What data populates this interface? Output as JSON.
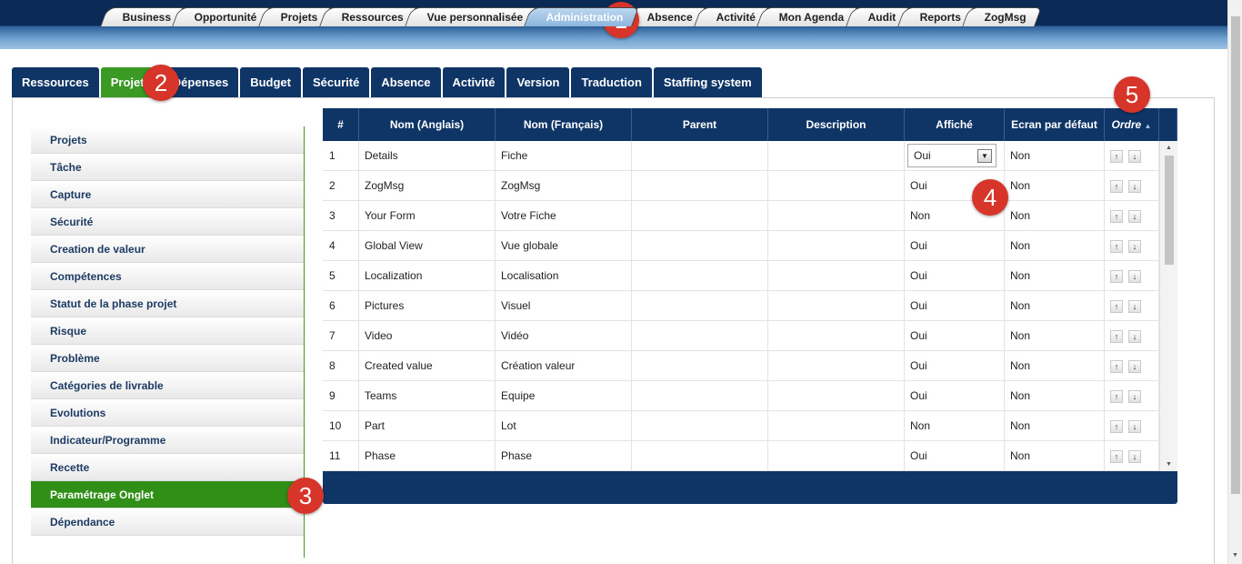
{
  "main_tabs": [
    "Business",
    "Opportunité",
    "Projets",
    "Ressources",
    "Vue personnalisée",
    "Administration",
    "Absence",
    "Activité",
    "Mon Agenda",
    "Audit",
    "Reports",
    "ZogMsg"
  ],
  "sub_tabs": [
    "Ressources",
    "Projets",
    "Dépenses",
    "Budget",
    "Sécurité",
    "Absence",
    "Activité",
    "Version",
    "Traduction",
    "Staffing system"
  ],
  "sidebar": {
    "items": [
      "Projets",
      "Tâche",
      "Capture",
      "Sécurité",
      "Creation de valeur",
      "Compétences",
      "Statut de la phase projet",
      "Risque",
      "Problème",
      "Catégories de livrable",
      "Evolutions",
      "Indicateur/Programme",
      "Recette",
      "Paramétrage Onglet",
      "Dépendance"
    ]
  },
  "grid": {
    "columns": {
      "num": "#",
      "name_en": "Nom (Anglais)",
      "name_fr": "Nom (Français)",
      "parent": "Parent",
      "description": "Description",
      "affiche": "Affiché",
      "ecran": "Ecran par défaut",
      "ordre": "Ordre"
    },
    "rows": [
      {
        "num": "1",
        "en": "Details",
        "fr": "Fiche",
        "parent": "",
        "desc": "",
        "affiche": "Oui",
        "ecran": "Non"
      },
      {
        "num": "2",
        "en": "ZogMsg",
        "fr": "ZogMsg",
        "parent": "",
        "desc": "",
        "affiche": "Oui",
        "ecran": "Non"
      },
      {
        "num": "3",
        "en": "Your Form",
        "fr": "Votre Fiche",
        "parent": "",
        "desc": "",
        "affiche": "Non",
        "ecran": "Non"
      },
      {
        "num": "4",
        "en": "Global View",
        "fr": "Vue globale",
        "parent": "",
        "desc": "",
        "affiche": "Oui",
        "ecran": "Non"
      },
      {
        "num": "5",
        "en": "Localization",
        "fr": "Localisation",
        "parent": "",
        "desc": "",
        "affiche": "Oui",
        "ecran": "Non"
      },
      {
        "num": "6",
        "en": "Pictures",
        "fr": "Visuel",
        "parent": "",
        "desc": "",
        "affiche": "Oui",
        "ecran": "Non"
      },
      {
        "num": "7",
        "en": "Video",
        "fr": "Vidéo",
        "parent": "",
        "desc": "",
        "affiche": "Oui",
        "ecran": "Non"
      },
      {
        "num": "8",
        "en": "Created value",
        "fr": "Création valeur",
        "parent": "",
        "desc": "",
        "affiche": "Oui",
        "ecran": "Non"
      },
      {
        "num": "9",
        "en": "Teams",
        "fr": "Equipe",
        "parent": "",
        "desc": "",
        "affiche": "Oui",
        "ecran": "Non"
      },
      {
        "num": "10",
        "en": "Part",
        "fr": "Lot",
        "parent": "",
        "desc": "",
        "affiche": "Non",
        "ecran": "Non"
      },
      {
        "num": "11",
        "en": "Phase",
        "fr": "Phase",
        "parent": "",
        "desc": "",
        "affiche": "Oui",
        "ecran": "Non"
      }
    ]
  },
  "callouts": [
    "1",
    "2",
    "3",
    "4",
    "5"
  ],
  "icons": {
    "sort": "sort-asc-icon",
    "up": "arrow-up-icon",
    "down": "arrow-down-icon",
    "dropdown": "chevron-down-icon"
  },
  "colors": {
    "header_dark": "#0b2a55",
    "tab_dark": "#0e3566",
    "active_green": "#3a9a23",
    "callout_red": "#d8352a"
  }
}
